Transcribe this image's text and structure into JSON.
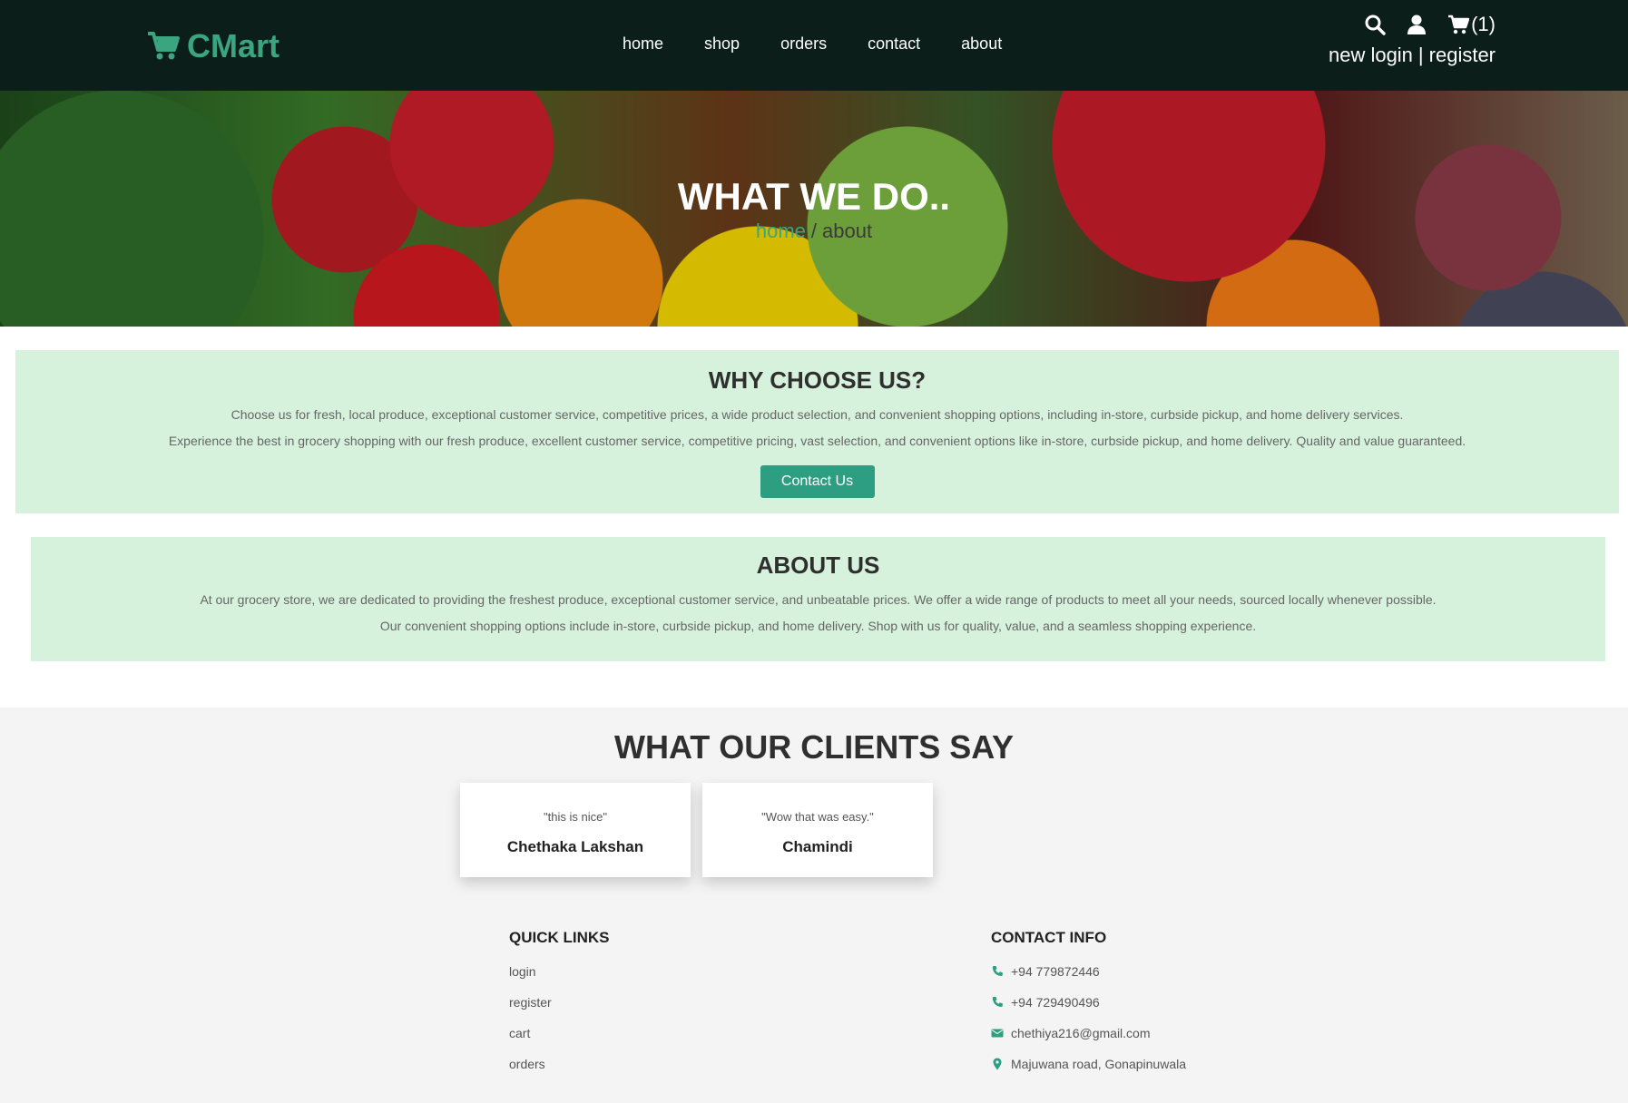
{
  "header": {
    "logo_text": "CMart",
    "nav": [
      "home",
      "shop",
      "orders",
      "contact",
      "about"
    ],
    "cart_count": "(1)",
    "account_new_login": "new login",
    "account_sep": "|",
    "account_register": "register",
    "icons": [
      "search-icon",
      "user-icon",
      "cart-icon"
    ]
  },
  "hero": {
    "title": "WHAT WE DO..",
    "breadcrumb_home": "home",
    "breadcrumb_sep": "/",
    "breadcrumb_current": "about"
  },
  "why": {
    "title": "WHY CHOOSE US?",
    "p1": "Choose us for fresh, local produce, exceptional customer service, competitive prices, a wide product selection, and convenient shopping options, including in-store, curbside pickup, and home delivery services.",
    "p2": "Experience the best in grocery shopping with our fresh produce, excellent customer service, competitive pricing, vast selection, and convenient options like in-store, curbside pickup, and home delivery. Quality and value guaranteed.",
    "button": "Contact Us"
  },
  "about": {
    "title": "ABOUT US",
    "p1": "At our grocery store, we are dedicated to providing the freshest produce, exceptional customer service, and unbeatable prices. We offer a wide range of products to meet all your needs, sourced locally whenever possible.",
    "p2": "Our convenient shopping options include in-store, curbside pickup, and home delivery. Shop with us for quality, value, and a seamless shopping experience."
  },
  "testimonials": {
    "title": "WHAT OUR CLIENTS SAY",
    "items": [
      {
        "quote": "\"this is nice\"",
        "name": "Chethaka Lakshan"
      },
      {
        "quote": "\"Wow that was easy.\"",
        "name": "Chamindi"
      }
    ]
  },
  "footer": {
    "quick_title": "QUICK LINKS",
    "quick_links": [
      "login",
      "register",
      "cart",
      "orders"
    ],
    "contact_title": "CONTACT INFO",
    "phone1": "+94 779872446",
    "phone2": "+94 729490496",
    "email": "chethiya216@gmail.com",
    "address": "Majuwana road, Gonapinuwala"
  },
  "colors": {
    "header_bg": "#0b1e19",
    "brand_green": "#3aa57f",
    "button_teal": "#2e9e82",
    "box_bg": "#d7f2dc"
  }
}
